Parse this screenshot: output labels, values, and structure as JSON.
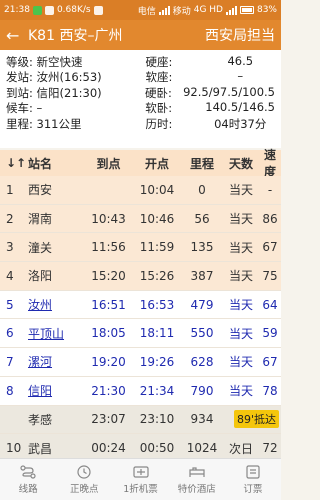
{
  "status_bar": {
    "time": "21:38",
    "network_speed": "0.68K/s",
    "carrier1": "电信",
    "carrier2": "移动",
    "network_type": "4G HD",
    "battery": "83%"
  },
  "header": {
    "back_icon": "back-arrow-icon",
    "title": "K81 西安–广州",
    "bureau": "西安局担当"
  },
  "info": [
    {
      "left": "等级: 新空快速",
      "right_key": "硬座:",
      "right_val": "46.5"
    },
    {
      "left": "发站: 汝州(16:53)",
      "right_key": "软座:",
      "right_val": "–"
    },
    {
      "left": "到站: 信阳(21:30)",
      "right_key": "硬卧:",
      "right_val": "92.5/97.5/100.5"
    },
    {
      "left": "候车: –",
      "right_key": "软卧:",
      "right_val": "140.5/146.5"
    },
    {
      "left": "里程: 311公里",
      "right_key": "历时:",
      "right_val": "04时37分"
    }
  ],
  "table": {
    "headers": {
      "sort_icon": "↓↑",
      "station": "站名",
      "arrive": "到点",
      "depart": "开点",
      "mileage": "里程",
      "days": "天数",
      "speed": "速度"
    },
    "rows": [
      {
        "no": "1",
        "station": "西安",
        "arrive": "",
        "depart": "10:04",
        "mileage": "0",
        "days": "当天",
        "speed": "-",
        "state": "past"
      },
      {
        "no": "2",
        "station": "渭南",
        "arrive": "10:43",
        "depart": "10:46",
        "mileage": "56",
        "days": "当天",
        "speed": "86",
        "state": "past"
      },
      {
        "no": "3",
        "station": "潼关",
        "arrive": "11:56",
        "depart": "11:59",
        "mileage": "135",
        "days": "当天",
        "speed": "67",
        "state": "past"
      },
      {
        "no": "4",
        "station": "洛阳",
        "arrive": "15:20",
        "depart": "15:26",
        "mileage": "387",
        "days": "当天",
        "speed": "75",
        "state": "past"
      },
      {
        "no": "5",
        "station": "汝州",
        "arrive": "16:51",
        "depart": "16:53",
        "mileage": "479",
        "days": "当天",
        "speed": "64",
        "state": "cur"
      },
      {
        "no": "6",
        "station": "平顶山",
        "arrive": "18:05",
        "depart": "18:11",
        "mileage": "550",
        "days": "当天",
        "speed": "59",
        "state": "cur"
      },
      {
        "no": "7",
        "station": "漯河",
        "arrive": "19:20",
        "depart": "19:26",
        "mileage": "628",
        "days": "当天",
        "speed": "67",
        "state": "cur"
      },
      {
        "no": "8",
        "station": "信阳",
        "arrive": "21:30",
        "depart": "21:34",
        "mileage": "790",
        "days": "当天",
        "speed": "78",
        "state": "cur"
      },
      {
        "no": "",
        "station": "孝感",
        "arrive": "23:07",
        "depart": "23:10",
        "mileage": "934",
        "days": "",
        "speed": "",
        "badge": "89'抵达",
        "state": "pending"
      },
      {
        "no": "10",
        "station": "武昌",
        "arrive": "00:24",
        "depart": "00:50",
        "mileage": "1024",
        "days": "次日",
        "speed": "72",
        "state": "pending"
      }
    ]
  },
  "bottom_nav": [
    {
      "label": "线路",
      "icon": "route-icon"
    },
    {
      "label": "正晚点",
      "icon": "clock-icon"
    },
    {
      "label": "1折机票",
      "icon": "ticket-icon"
    },
    {
      "label": "特价酒店",
      "icon": "hotel-icon"
    },
    {
      "label": "订票",
      "icon": "booking-icon"
    }
  ],
  "colors": {
    "header": "#e2882e",
    "status_bar": "#da7e26",
    "current_text": "#1f2ab0",
    "badge": "#f4c60c"
  }
}
